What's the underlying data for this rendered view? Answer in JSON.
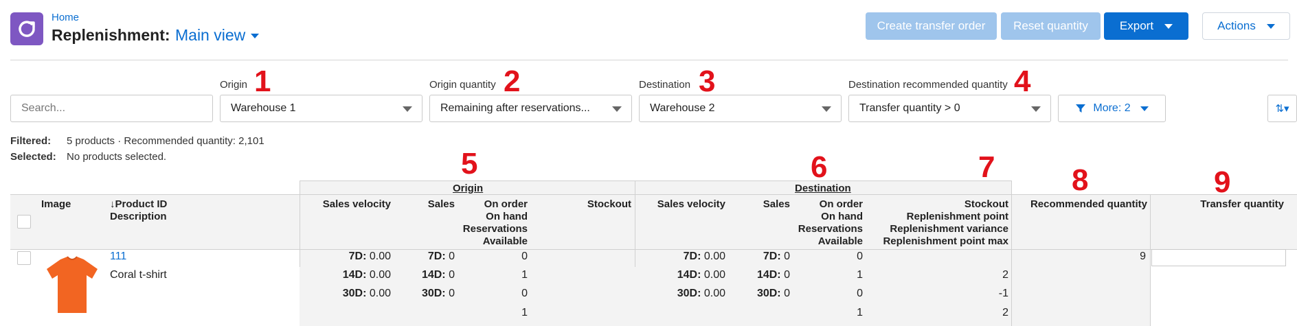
{
  "header": {
    "breadcrumb": "Home",
    "title": "Replenishment:",
    "view": "Main view",
    "buttons": {
      "create_transfer": "Create transfer order",
      "reset_quantity": "Reset quantity",
      "export": "Export",
      "actions": "Actions"
    }
  },
  "filters": {
    "search_placeholder": "Search...",
    "origin": {
      "label": "Origin",
      "value": "Warehouse 1",
      "marker": "1"
    },
    "origin_quantity": {
      "label": "Origin quantity",
      "value": "Remaining after reservations...",
      "marker": "2"
    },
    "destination": {
      "label": "Destination",
      "value": "Warehouse 2",
      "marker": "3"
    },
    "dest_recommended": {
      "label": "Destination recommended quantity",
      "value": "Transfer quantity > 0",
      "marker": "4"
    },
    "more": "More: 2"
  },
  "summary": {
    "filtered_label": "Filtered:",
    "filtered_value": "5 products · Recommended quantity: 2,101",
    "selected_label": "Selected:",
    "selected_value": "No products selected."
  },
  "markers": {
    "origin": "5",
    "destination": "6",
    "stockout": "7",
    "recommended": "8",
    "transfer": "9"
  },
  "table": {
    "groups": {
      "origin": "Origin",
      "destination": "Destination"
    },
    "headers": {
      "image": "Image",
      "product_id": "↓Product ID",
      "description": "Description",
      "o_sales_velocity": "Sales velocity",
      "o_sales": "Sales",
      "o_on_order": "On order",
      "o_on_hand": "On hand",
      "o_reservations": "Reservations",
      "o_available": "Available",
      "o_stockout": "Stockout",
      "d_sales_velocity": "Sales velocity",
      "d_sales": "Sales",
      "d_on_order": "On order",
      "d_on_hand": "On hand",
      "d_reservations": "Reservations",
      "d_available": "Available",
      "d_stockout": "Stockout",
      "d_rp": "Replenishment point",
      "d_rv": "Replenishment variance",
      "d_rpm": "Replenishment point max",
      "recommended": "Recommended quantity",
      "transfer": "Transfer quantity"
    },
    "row": {
      "product_id": "111",
      "description": "Coral t-shirt",
      "period_labels": [
        "7D:",
        "14D:",
        "30D:"
      ],
      "origin_velocity": [
        "0.00",
        "0.00",
        "0.00"
      ],
      "origin_sales": [
        "0",
        "0",
        "0"
      ],
      "origin_stock": [
        "0",
        "1",
        "0",
        "1"
      ],
      "dest_velocity": [
        "0.00",
        "0.00",
        "0.00"
      ],
      "dest_sales": [
        "0",
        "0",
        "0"
      ],
      "dest_stock": [
        "0",
        "1",
        "0",
        "1"
      ],
      "dest_replenishment": [
        "",
        "2",
        "-1",
        "2"
      ],
      "recommended": "9",
      "transfer": ""
    }
  },
  "colors": {
    "accent": "#0a6ed1",
    "marker": "#e2121b",
    "app_icon": "#7e57c2"
  }
}
